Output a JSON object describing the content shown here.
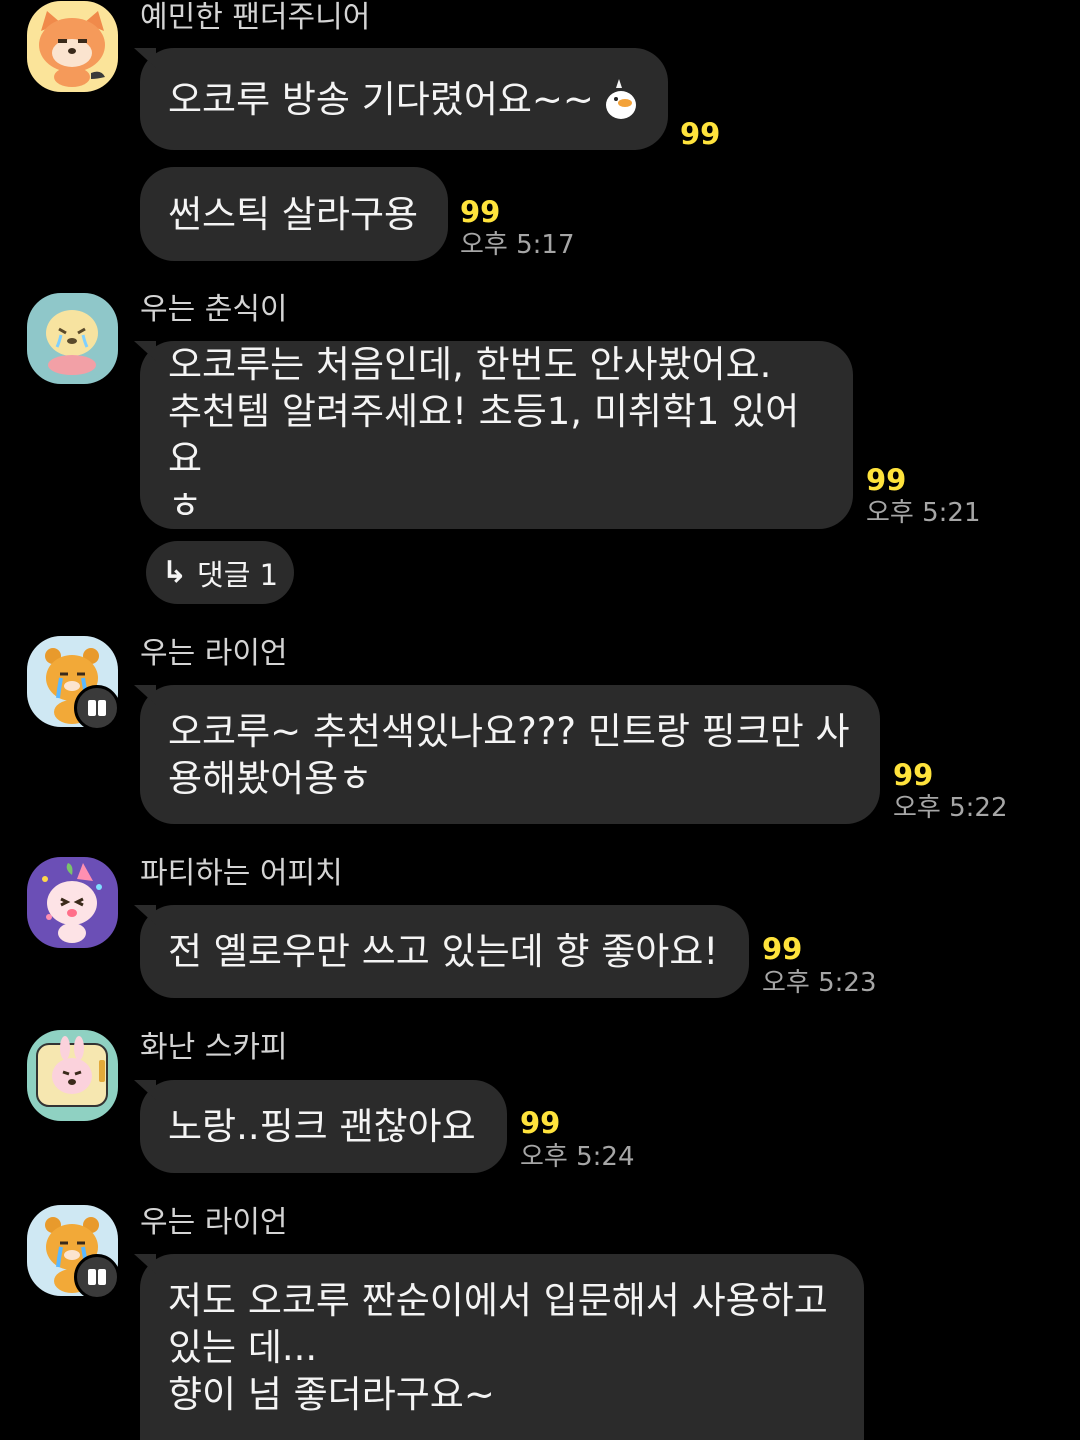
{
  "colors": {
    "background": "#000000",
    "bubble": "#2b2b2b",
    "unread": "#ffe33c",
    "sender": "#d4d4d4",
    "time": "#a6a6a6"
  },
  "messages": [
    {
      "sender": "예민한 팬더주니어",
      "avatar_icon": "panda-junior-avatar-icon",
      "bubbles": [
        {
          "text": "오코루 방송 기다렸어요~~",
          "emoji": "duck-emoticon-icon",
          "unread": "99",
          "time": ""
        },
        {
          "text": "썬스틱 살라구용",
          "unread": "99",
          "time": "오후 5:17"
        }
      ]
    },
    {
      "sender": "우는 춘식이",
      "avatar_icon": "crying-choonsik-avatar-icon",
      "bubbles": [
        {
          "text": "오코루는 처음인데, 한번도 안사봤어요.\n추천템 알려주세요! 초등1, 미취학1 있어요\nㅎ",
          "unread": "99",
          "time": "오후 5:21"
        }
      ],
      "reply": {
        "icon": "reply-arrow-icon",
        "label": "댓글 1"
      }
    },
    {
      "sender": "우는 라이언",
      "avatar_icon": "crying-ryan-avatar-icon",
      "bubbles": [
        {
          "text": "오코루~ 추천색있나요??? 민트랑 핑크만 사\n용해봤어용ㅎ",
          "unread": "99",
          "time": "오후 5:22"
        }
      ]
    },
    {
      "sender": "파티하는 어피치",
      "avatar_icon": "party-apeach-avatar-icon",
      "bubbles": [
        {
          "text": "전 옐로우만 쓰고 있는데 향 좋아요!",
          "unread": "99",
          "time": "오후 5:23"
        }
      ]
    },
    {
      "sender": "화난 스카피",
      "avatar_icon": "angry-scappy-avatar-icon",
      "bubbles": [
        {
          "text": "노랑..핑크 괜찮아요",
          "unread": "99",
          "time": "오후 5:24"
        }
      ]
    },
    {
      "sender": "우는 라이언",
      "avatar_icon": "crying-ryan-avatar-icon",
      "bubbles": [
        {
          "text": "저도 오코루 짠순이에서 입문해서 사용하고\n있는 데...\n향이 넘 좋더라구요~",
          "unread": "",
          "time": ""
        }
      ]
    }
  ]
}
